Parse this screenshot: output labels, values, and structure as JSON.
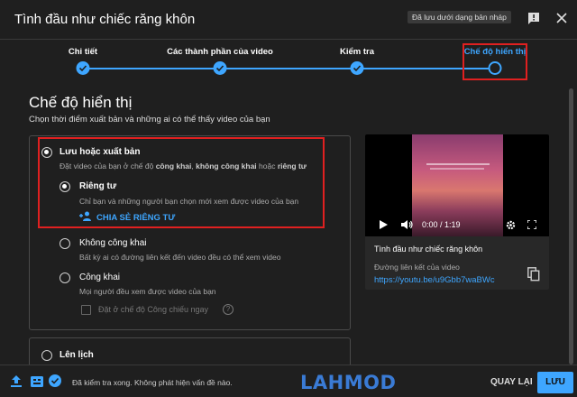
{
  "header": {
    "title": "Tình đầu như chiếc răng khôn",
    "draft_badge": "Đã lưu dưới dạng bản nháp"
  },
  "stepper": {
    "steps": [
      {
        "label": "Chi tiết",
        "state": "done"
      },
      {
        "label": "Các thành phần của video",
        "state": "done"
      },
      {
        "label": "Kiểm tra",
        "state": "done"
      },
      {
        "label": "Chế độ hiển thị",
        "state": "current"
      }
    ]
  },
  "visibility": {
    "title": "Chế độ hiển thị",
    "subtitle": "Chọn thời điểm xuất bản và những ai có thể thấy video của bạn",
    "save_publish": {
      "title": "Lưu hoặc xuất bản",
      "desc_prefix": "Đặt video của bạn ở chế độ ",
      "desc_bold1": "công khai",
      "desc_sep": ", ",
      "desc_bold2": "không công khai",
      "desc_mid": " hoặc ",
      "desc_bold3": "riêng tư",
      "selected": true
    },
    "private": {
      "title": "Riêng tư",
      "desc": "Chỉ bạn và những người bạn chọn mới xem được video của bạn",
      "share_label": "CHIA SẺ RIÊNG TƯ",
      "selected": true
    },
    "unlisted": {
      "title": "Không công khai",
      "desc": "Bất kỳ ai có đường liên kết đến video đều có thể xem video"
    },
    "public": {
      "title": "Công khai",
      "desc": "Mọi người đều xem được video của bạn",
      "premiere_label": "Đặt ở chế độ Công chiếu ngay"
    },
    "schedule": {
      "title": "Lên lịch"
    }
  },
  "preview": {
    "time": "0:00 / 1:19",
    "video_title": "Tình đầu như chiếc răng khôn",
    "link_label": "Đường liên kết của video",
    "link": "https://youtu.be/u9Gbb7waBWc"
  },
  "footer": {
    "status": "Đã kiểm tra xong. Không phát hiện vấn đề nào.",
    "watermark": "LAHMOD",
    "back_label": "QUAY LẠI",
    "save_label": "LƯU"
  },
  "colors": {
    "accent": "#3ea6ff",
    "highlight": "#e02020",
    "background": "#1f1f1f"
  }
}
